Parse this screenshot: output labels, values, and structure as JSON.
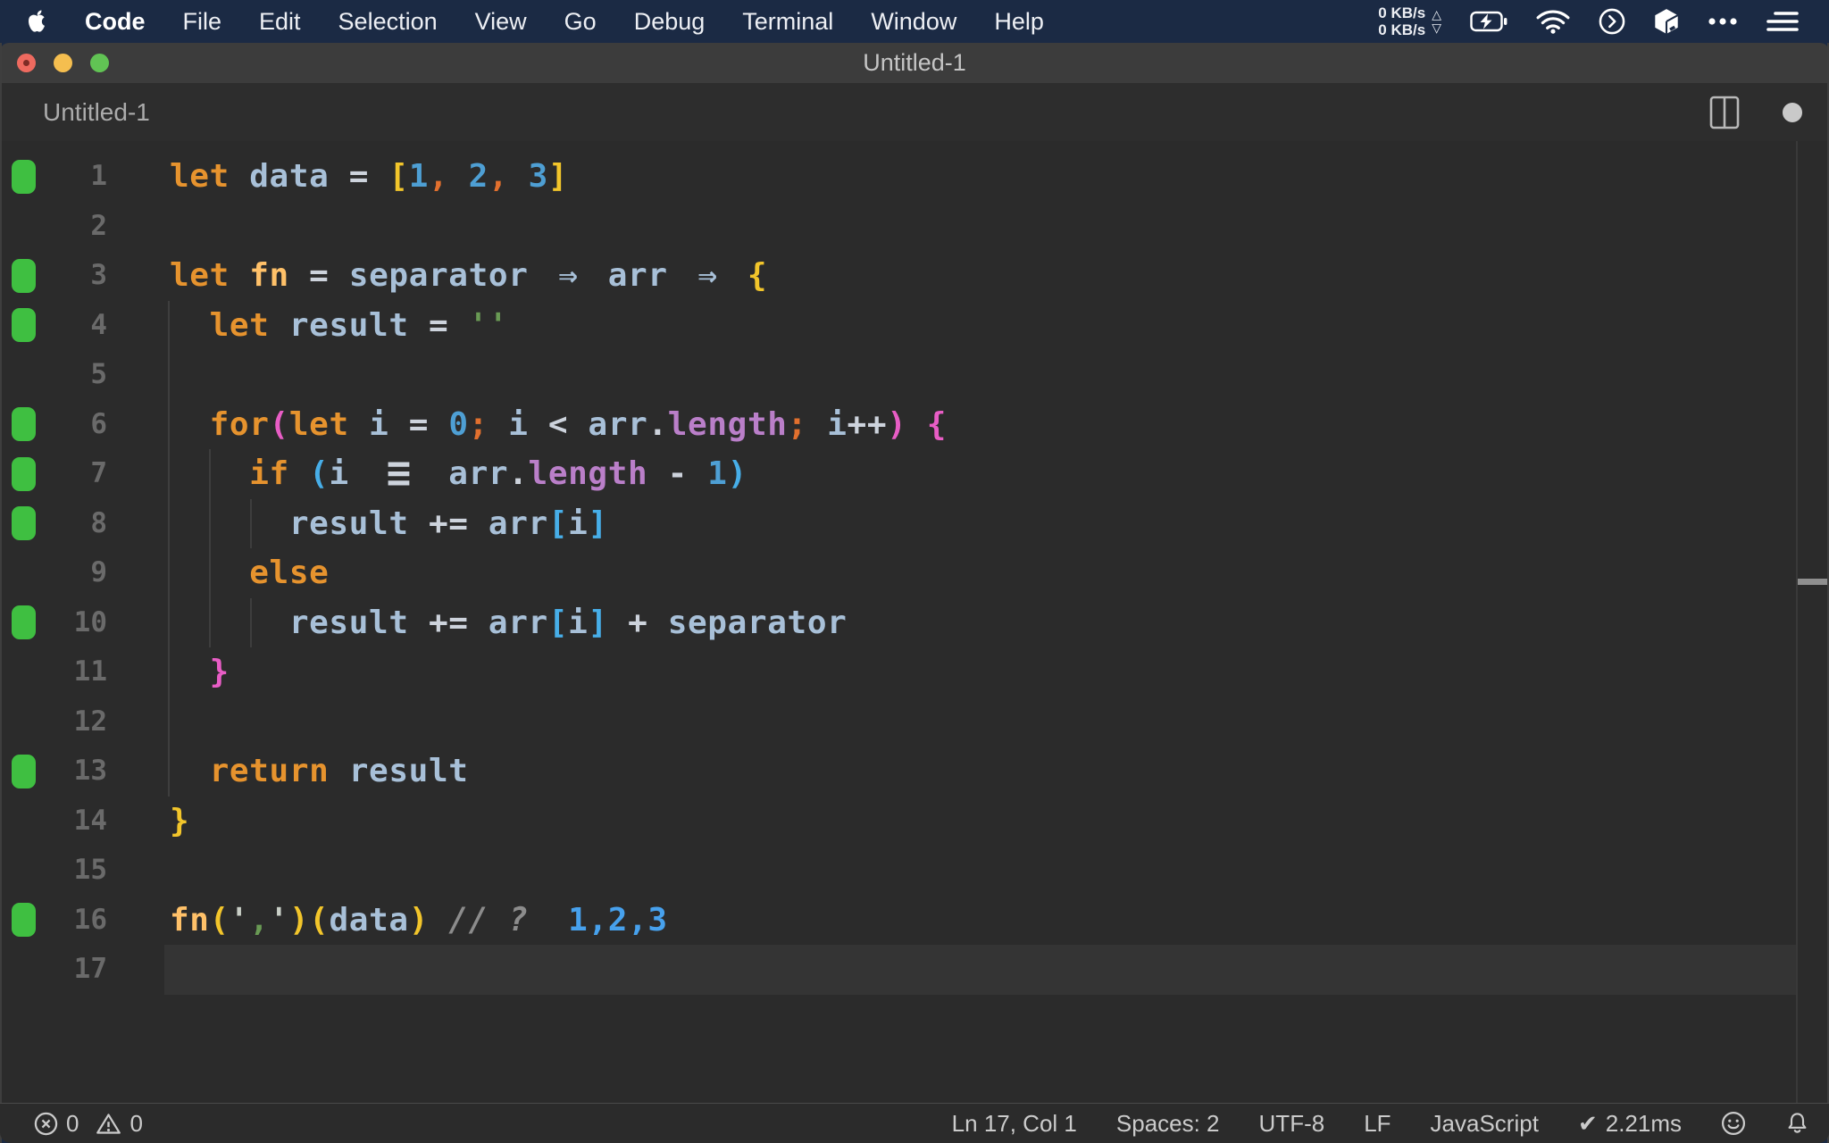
{
  "menu_bar": {
    "items": [
      {
        "label": "Code",
        "bold": true
      },
      {
        "label": "File"
      },
      {
        "label": "Edit"
      },
      {
        "label": "Selection"
      },
      {
        "label": "View"
      },
      {
        "label": "Go"
      },
      {
        "label": "Debug"
      },
      {
        "label": "Terminal"
      },
      {
        "label": "Window"
      },
      {
        "label": "Help"
      }
    ],
    "network": {
      "up": "0 KB/s",
      "down": "0 KB/s",
      "up_arrow": "△",
      "down_arrow": "▽"
    },
    "status_icons": [
      "battery-charging-icon",
      "wifi-icon",
      "circle-chevron-icon",
      "package-icon",
      "more-dots-icon",
      "list-icon"
    ],
    "more_dots": "•••",
    "colors": {
      "background": "#1B2A44",
      "text": "#EDEFF4"
    }
  },
  "window": {
    "title": "Untitled-1",
    "titlebar_color": "#3C3C3C",
    "traffic_lights": [
      "close-red-edited",
      "minimize-yellow",
      "zoom-green"
    ]
  },
  "tab_bar": {
    "title": "Untitled-1",
    "dirty": true
  },
  "editor": {
    "language_mode": "JavaScript",
    "background": "#2B2B2B",
    "current_line": 17,
    "cursor": "Ln 17, Col 1",
    "modified_lines": [
      1,
      3,
      4,
      6,
      7,
      8,
      10,
      13,
      16
    ],
    "indent_guides": [
      {
        "level": 0,
        "from": 4,
        "to": 13
      },
      {
        "level": 1,
        "from": 7,
        "to": 10
      },
      {
        "level": 2,
        "from": 8,
        "to": 8
      },
      {
        "level": 2,
        "from": 10,
        "to": 10
      }
    ],
    "token_colors": {
      "kw": {
        "color": "#E6932E"
      },
      "fname": {
        "color": "#FFC169"
      },
      "var": {
        "color": "#A8C0D8"
      },
      "op": {
        "color": "#CDD3DC"
      },
      "num": {
        "color": "#4E9FD4"
      },
      "punct": {
        "color": "#E2702E"
      },
      "b1": {
        "color": "#F2C52B"
      },
      "b2": {
        "color": "#E85DC5"
      },
      "b3": {
        "color": "#47AEE8"
      },
      "prop": {
        "color": "#BA7FC9"
      },
      "str": {
        "color": "#699A54"
      },
      "q": {
        "color": "#C9CFC7"
      },
      "cmt": {
        "color": "#8C8C8C",
        "italic": true
      },
      "quokka": {
        "color": "#47A1ED"
      },
      "arrow": {
        "color": "#A8C0D8"
      },
      "plain": {
        "color": "#D8D8D8"
      }
    },
    "lines": [
      {
        "tokens": [
          [
            "let",
            "kw"
          ],
          [
            " "
          ],
          [
            "data",
            "var"
          ],
          [
            " "
          ],
          [
            "=",
            "op"
          ],
          [
            " "
          ],
          [
            "[",
            "b1"
          ],
          [
            "1",
            "num"
          ],
          [
            ",",
            "punct"
          ],
          [
            " "
          ],
          [
            "2",
            "num"
          ],
          [
            ",",
            "punct"
          ],
          [
            " "
          ],
          [
            "3",
            "num"
          ],
          [
            "]",
            "b1"
          ]
        ]
      },
      {
        "tokens": []
      },
      {
        "tokens": [
          [
            "let",
            "kw"
          ],
          [
            " "
          ],
          [
            "fn",
            "fname"
          ],
          [
            " "
          ],
          [
            "=",
            "op"
          ],
          [
            " "
          ],
          [
            "separator",
            "var"
          ],
          [
            " "
          ],
          [
            "⇒",
            "arrow",
            2
          ],
          [
            " "
          ],
          [
            "arr",
            "var"
          ],
          [
            " "
          ],
          [
            "⇒",
            "arrow",
            2
          ],
          [
            " "
          ],
          [
            "{",
            "b1"
          ]
        ]
      },
      {
        "tokens": [
          [
            "  "
          ],
          [
            "let",
            "kw"
          ],
          [
            " "
          ],
          [
            "result",
            "var"
          ],
          [
            " "
          ],
          [
            "=",
            "op"
          ],
          [
            " "
          ],
          [
            "''",
            "str"
          ]
        ]
      },
      {
        "tokens": []
      },
      {
        "tokens": [
          [
            "  "
          ],
          [
            "for",
            "kw"
          ],
          [
            "(",
            "b2"
          ],
          [
            "let",
            "kw"
          ],
          [
            " "
          ],
          [
            "i",
            "var"
          ],
          [
            " "
          ],
          [
            "=",
            "op"
          ],
          [
            " "
          ],
          [
            "0",
            "num"
          ],
          [
            ";",
            "punct"
          ],
          [
            " "
          ],
          [
            "i",
            "var"
          ],
          [
            " "
          ],
          [
            "<",
            "op"
          ],
          [
            " "
          ],
          [
            "arr",
            "var"
          ],
          [
            ".",
            "op"
          ],
          [
            "length",
            "prop"
          ],
          [
            ";",
            "punct"
          ],
          [
            " "
          ],
          [
            "i",
            "var"
          ],
          [
            "++",
            "op"
          ],
          [
            ")",
            "b2"
          ],
          [
            " "
          ],
          [
            "{",
            "b2"
          ]
        ]
      },
      {
        "tokens": [
          [
            "    "
          ],
          [
            "if",
            "kw"
          ],
          [
            " "
          ],
          [
            "(",
            "b3"
          ],
          [
            "i",
            "var"
          ],
          [
            " "
          ],
          [
            "≡",
            "op",
            3
          ],
          [
            " "
          ],
          [
            "arr",
            "var"
          ],
          [
            ".",
            "op"
          ],
          [
            "length",
            "prop"
          ],
          [
            " "
          ],
          [
            "-",
            "op"
          ],
          [
            " "
          ],
          [
            "1",
            "num"
          ],
          [
            ")",
            "b3"
          ]
        ]
      },
      {
        "tokens": [
          [
            "      "
          ],
          [
            "result",
            "var"
          ],
          [
            " "
          ],
          [
            "+=",
            "op"
          ],
          [
            " "
          ],
          [
            "arr",
            "var"
          ],
          [
            "[",
            "b3"
          ],
          [
            "i",
            "var"
          ],
          [
            "]",
            "b3"
          ]
        ]
      },
      {
        "tokens": [
          [
            "    "
          ],
          [
            "else",
            "kw"
          ]
        ]
      },
      {
        "tokens": [
          [
            "      "
          ],
          [
            "result",
            "var"
          ],
          [
            " "
          ],
          [
            "+=",
            "op"
          ],
          [
            " "
          ],
          [
            "arr",
            "var"
          ],
          [
            "[",
            "b3"
          ],
          [
            "i",
            "var"
          ],
          [
            "]",
            "b3"
          ],
          [
            " "
          ],
          [
            "+",
            "op"
          ],
          [
            " "
          ],
          [
            "separator",
            "var"
          ]
        ]
      },
      {
        "tokens": [
          [
            "  "
          ],
          [
            "}",
            "b2"
          ]
        ]
      },
      {
        "tokens": []
      },
      {
        "tokens": [
          [
            "  "
          ],
          [
            "return",
            "kw"
          ],
          [
            " "
          ],
          [
            "result",
            "var"
          ]
        ]
      },
      {
        "tokens": [
          [
            "}",
            "b1"
          ]
        ]
      },
      {
        "tokens": []
      },
      {
        "tokens": [
          [
            "fn",
            "fname"
          ],
          [
            "(",
            "b1"
          ],
          [
            "'",
            "q"
          ],
          [
            ",",
            "str"
          ],
          [
            "'",
            "q"
          ],
          [
            ")",
            "b1"
          ],
          [
            "(",
            "b1"
          ],
          [
            "data",
            "var"
          ],
          [
            ")",
            "b1"
          ],
          [
            " "
          ],
          [
            "//",
            "cmt"
          ],
          [
            " "
          ],
          [
            "?",
            "cmt"
          ],
          [
            "  "
          ],
          [
            "1,2,3",
            "quokka"
          ]
        ]
      },
      {
        "tokens": []
      }
    ]
  },
  "status_bar": {
    "errors": "0",
    "warnings": "0",
    "cursor_position": "Ln 17, Col 1",
    "indentation": "Spaces: 2",
    "encoding": "UTF-8",
    "eol": "LF",
    "language": "JavaScript",
    "perf_check": "✔",
    "perf_time": "2.21ms"
  }
}
